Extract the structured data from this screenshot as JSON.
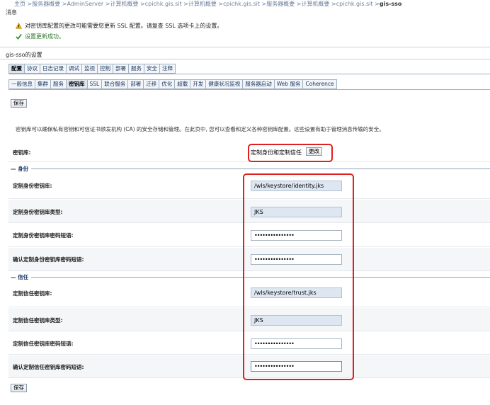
{
  "breadcrumb": {
    "path": "主页 >服务器概要 >AdminServer >计算机概要 >cpichk.gis.sit >计算机概要 >cpichk.gis.sit >服务器概要 >计算机概要 >cpichk.gis.sit >",
    "current": "gis-sso"
  },
  "messages": {
    "title": "消息",
    "warning": "对密钥库配置的更改可能需要您更新 SSL 配置。请复查 SSL 选项卡上的设置。",
    "success": "设置更新成功。"
  },
  "settings_title": "gis-sso的设置",
  "tabs_primary": [
    "配置",
    "协议",
    "日志记录",
    "调试",
    "监视",
    "控制",
    "部署",
    "服务",
    "安全",
    "注释"
  ],
  "tabs_secondary": [
    "一般信息",
    "集群",
    "服务",
    "密钥库",
    "SSL",
    "联合服务",
    "部署",
    "迁移",
    "优化",
    "超载",
    "开发",
    "健康状况监视",
    "服务器启动",
    "Web 服务",
    "Coherence"
  ],
  "save_label": "保存",
  "description": "密钥库可以确保私有密钥和可信证书颁发机构 (CA) 的安全存储和管理。在此页中, 您可以查看和定义各种密钥库配置。这些设置有助于管理消息传输的安全。",
  "keystore": {
    "label": "密钥库:",
    "value": "定制身份和定制信任",
    "change_label": "更改"
  },
  "identity": {
    "section": "身份",
    "keystore_label": "定制身份密钥库:",
    "keystore_value": "/wls/keystore/identity.jks",
    "type_label": "定制身份密钥库类型:",
    "type_value": "JKS",
    "pass_label": "定制身份密钥库密码短语:",
    "pass_value": "•••••••••••••••",
    "confirm_label": "确认定制身份密钥库密码短语:",
    "confirm_value": "•••••••••••••••"
  },
  "trust": {
    "section": "信任",
    "keystore_label": "定制信任密钥库:",
    "keystore_value": "/wls/keystore/trust.jks",
    "type_label": "定制信任密钥库类型:",
    "type_value": "JKS",
    "pass_label": "定制信任密钥库密码短语:",
    "pass_value": "•••••••••••••••",
    "confirm_label": "确认定制信任密钥库密码短语:",
    "confirm_value": "•••••••••••••••"
  },
  "colors": {
    "highlight_box": "#e02020",
    "readonly_field": "#dde6f1",
    "tab_active": "#dfe6ef"
  }
}
